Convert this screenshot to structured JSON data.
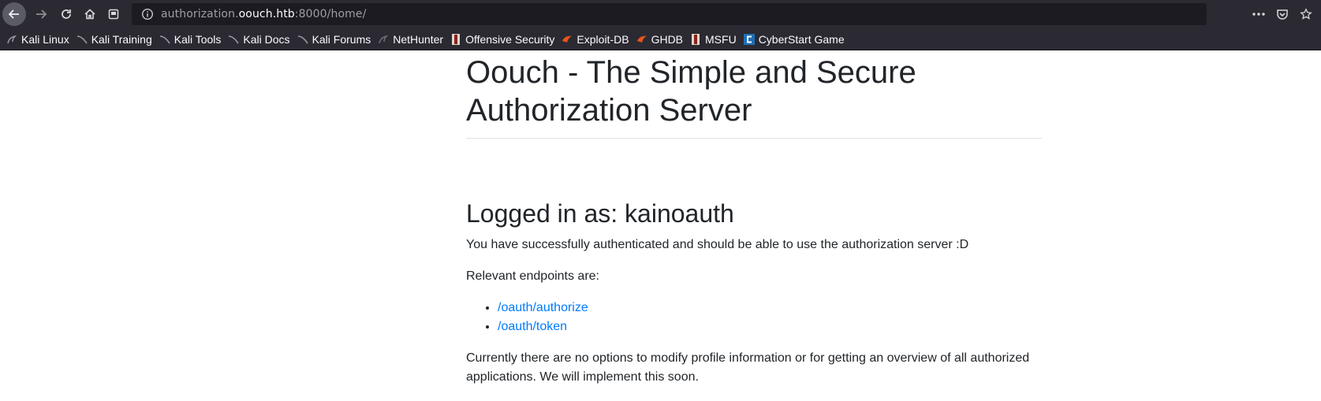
{
  "browser": {
    "url_prefix": "authorization.",
    "url_host": "oouch.htb",
    "url_suffix": ":8000/home/"
  },
  "bookmarks": [
    {
      "label": "Kali Linux",
      "icon": "kali-dragon-icon"
    },
    {
      "label": "Kali Training",
      "icon": "kali-dragon-icon"
    },
    {
      "label": "Kali Tools",
      "icon": "kali-dragon-icon"
    },
    {
      "label": "Kali Docs",
      "icon": "kali-dragon-icon"
    },
    {
      "label": "Kali Forums",
      "icon": "kali-dragon-icon"
    },
    {
      "label": "NetHunter",
      "icon": "kali-dragon-icon"
    },
    {
      "label": "Offensive Security",
      "icon": "offsec-icon"
    },
    {
      "label": "Exploit-DB",
      "icon": "exploitdb-icon"
    },
    {
      "label": "GHDB",
      "icon": "exploitdb-icon"
    },
    {
      "label": "MSFU",
      "icon": "offsec-icon"
    },
    {
      "label": "CyberStart Game",
      "icon": "cyberstart-icon"
    }
  ],
  "page": {
    "title": "Oouch - The Simple and Secure Authorization Server",
    "logged_in": "Logged in as: kainoauth",
    "success_text": "You have successfully authenticated and should be able to use the authorization server :D",
    "endpoints_intro": "Relevant endpoints are:",
    "endpoints": [
      "/oauth/authorize",
      "/oauth/token"
    ],
    "footer_text": "Currently there are no options to modify profile information or for getting an overview of all authorized applications. We will implement this soon."
  },
  "colors": {
    "link": "#007bff",
    "text": "#212529",
    "toolbar": "#2b2a33"
  }
}
